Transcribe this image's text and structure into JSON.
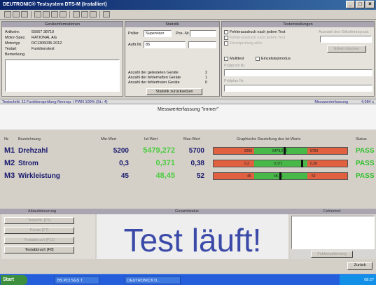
{
  "window": {
    "title": "DEUTRONIC® Testsystem DTS-M (Installiert)",
    "min": "_",
    "max": "□",
    "close": "×"
  },
  "geraete": {
    "header": "Geräteinformationen",
    "rows": [
      {
        "k": "Artikelnr.",
        "v": "55667 38710"
      },
      {
        "k": "Motor-Spez.",
        "v": "RATIONAL AG"
      },
      {
        "k": "Motortyp",
        "v": "RC1305035-2012"
      },
      {
        "k": "Testart",
        "v": "Funktionstest"
      },
      {
        "k": "Bemerkung",
        "v": ""
      }
    ]
  },
  "statistik": {
    "header": "Statistik",
    "pruefer_label": "Prüfer",
    "pruefer_value": "Supervisor",
    "pos_label": "Pos.-Nr.",
    "auftrag_label": "Auftr.Nr.",
    "auftrag_value": "85",
    "rows": [
      {
        "k": "Anzahl der getesteten Geräte",
        "v": "2"
      },
      {
        "k": "Anzahl der fehlerhaften Geräte",
        "v": "1"
      },
      {
        "k": "Anzahl der fehlerfreien Geräte",
        "v": "0"
      }
    ],
    "reset_label": "Statistik zurücksetzen"
  },
  "testeinstellungen": {
    "header": "Testeinstellungen",
    "opt1": "Fehlerausdruck nach jedem Test",
    "opt1_right": "Auswahl des Etikettenlayouts",
    "opt2": "Fehlerausdruck nach jedem Test",
    "opt3": "Einzelprüfung aktiv",
    "etikett_button": "Etikett drucken",
    "multitest": "Multitest",
    "einzelstep": "Einzelstepmodus",
    "drop1": "Prüfprofil Nr.",
    "drop2": "Prüfplan Nr."
  },
  "statusline": {
    "left": "Testschritt: 11  Funktionsprüfung  Nennsp. / PWN 100% (St.: 4)",
    "mid": "Messwerterfassung",
    "right": "4,984 s"
  },
  "message": "Messwerterfassung \"immer\"",
  "table_header": {
    "nr": "Nr.",
    "bez": "Bezeichnung",
    "min": "Min-Wert",
    "ist": "Ist-Wert",
    "max": "Max-Wert",
    "graph": "Graphische Darstellung des Ist-Werts",
    "status": "Status"
  },
  "measurements": [
    {
      "id": "M1",
      "name": "Drehzahl",
      "min": "5200",
      "ist": "5479,272",
      "max": "5700",
      "lo": "5200",
      "mid": "5479,272",
      "hi": "5700",
      "pos": 0.56,
      "status": "PASS"
    },
    {
      "id": "M2",
      "name": "Strom",
      "min": "0,3",
      "ist": "0,371",
      "max": "0,38",
      "lo": "0,3",
      "mid": "0,371",
      "hi": "0,38",
      "pos": 0.89,
      "status": "PASS"
    },
    {
      "id": "M3",
      "name": "Wirkleistung",
      "min": "45",
      "ist": "48,45",
      "max": "52",
      "lo": "45",
      "mid": "48,45",
      "hi": "52",
      "pos": 0.49,
      "status": "PASS"
    }
  ],
  "ablauf": {
    "header": "Ablaufsteuerung",
    "buttons": [
      {
        "label": "Testschr.",
        "key": "[F5]"
      },
      {
        "label": "Pause",
        "key": "[F7]"
      },
      {
        "label": "Testabbruch",
        "key": "[F11]"
      },
      {
        "label": "Testabbruch",
        "key": "[F8]"
      }
    ]
  },
  "gesamtstatus": {
    "header": "Gesamtstatus",
    "text": "Test läuft!"
  },
  "fehlertext": {
    "header": "Fehlertext",
    "quit": "Fehlerquittierung",
    "back": "Zurück"
  },
  "taskbar": {
    "start": "Start",
    "tasks": [
      "BS PCI SGS T",
      "DEUTRONIC® D..."
    ],
    "clock": "08:27"
  }
}
